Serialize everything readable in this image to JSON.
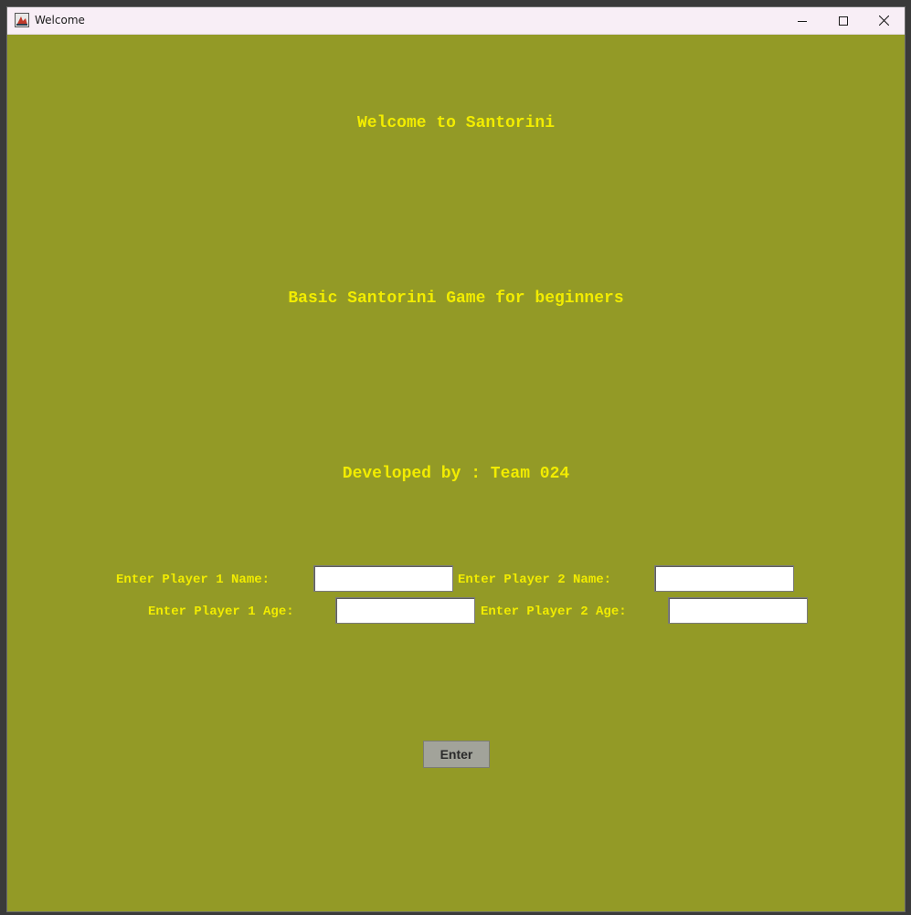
{
  "window": {
    "title": "Welcome",
    "icon": "java-app-icon",
    "controls": [
      "minimize-icon",
      "maximize-icon",
      "close-icon"
    ]
  },
  "welcome": {
    "title": "Welcome to Santorini",
    "subtitle": "Basic Santorini Game for beginners",
    "developer": "Developed by : Team 024"
  },
  "form": {
    "player1_name_label": "Enter Player 1 Name:",
    "player1_name_value": "",
    "player2_name_label": "Enter Player 2 Name:",
    "player2_name_value": "",
    "player1_age_label": "Enter Player 1 Age:",
    "player1_age_value": "",
    "player2_age_label": "Enter Player 2 Age:",
    "player2_age_value": ""
  },
  "actions": {
    "enter_label": "Enter"
  },
  "colors": {
    "background": "#939a26",
    "text": "#f2ec00",
    "button": "#a2a39a",
    "titlebar": "#f8eef6"
  }
}
